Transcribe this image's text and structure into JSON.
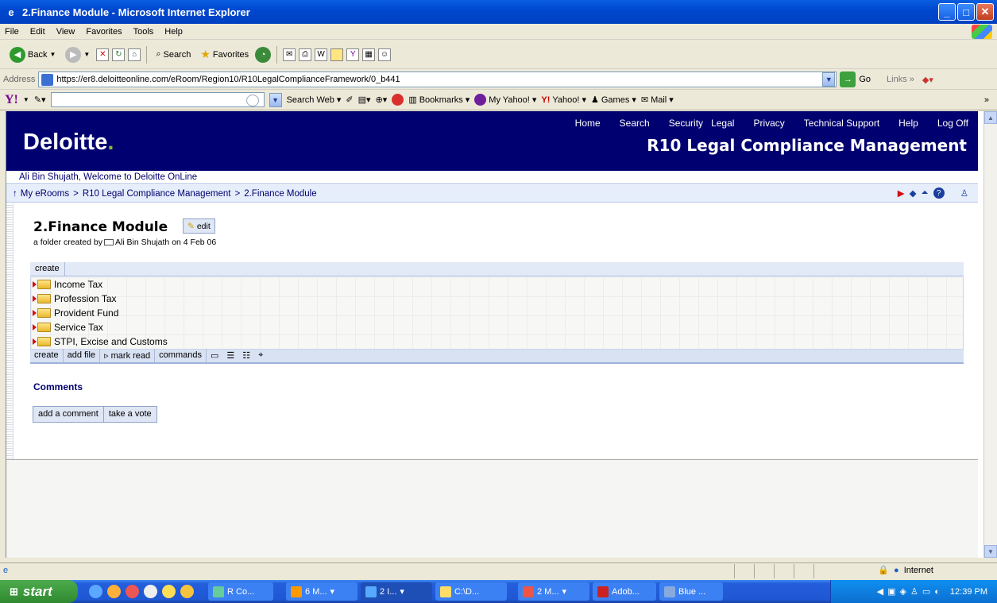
{
  "window": {
    "title": "2.Finance Module - Microsoft Internet Explorer",
    "min_icon": "minimize-icon",
    "max_icon": "maximize-icon",
    "close_icon": "close-icon"
  },
  "menu": [
    "File",
    "Edit",
    "View",
    "Favorites",
    "Tools",
    "Help"
  ],
  "toolbar": {
    "back": "Back",
    "search": "Search",
    "favorites": "Favorites"
  },
  "address": {
    "label": "Address",
    "url": "https://er8.deloitteonline.com/eRoom/Region10/R10LegalComplianceFramework/0_b441",
    "go": "Go",
    "links": "Links"
  },
  "yahoo": {
    "search_web": "Search Web",
    "bookmarks": "Bookmarks",
    "my_yahoo": "My Yahoo!",
    "yahoo": "Yahoo!",
    "games": "Games",
    "mail": "Mail"
  },
  "site": {
    "brand": "Deloitte",
    "brand_dot": ".",
    "nav": [
      "Home",
      "Search",
      "Security",
      "Legal",
      "Privacy",
      "Technical Support",
      "Help",
      "Log Off"
    ],
    "eroom_title": "R10 Legal Compliance Management",
    "welcome": "Ali Bin Shujath, Welcome to Deloitte OnLine",
    "breadcrumb": [
      "My eRooms",
      "R10 Legal Compliance Management",
      "2.Finance Module"
    ],
    "breadcrumb_sep": ">"
  },
  "folder": {
    "title": "2.Finance Module",
    "edit": "edit",
    "byline_prefix": "a folder created by",
    "author": "Ali Bin Shujath",
    "byline_suffix": "on 4 Feb 06",
    "create": "create",
    "items": [
      "Income Tax",
      "Profession Tax",
      "Provident Fund",
      "Service Tax",
      "STPI, Excise and Customs"
    ],
    "bottom_toolbar": [
      "create",
      "add file",
      "mark read",
      "commands"
    ]
  },
  "comments": {
    "heading": "Comments",
    "add": "add a comment",
    "vote": "take a vote"
  },
  "status": {
    "zone": "Internet"
  },
  "taskbar": {
    "start": "start",
    "buttons": [
      "R Co...",
      "6 M...",
      "2 I...",
      "C:\\D...",
      "2 M...",
      "Adob...",
      "Blue ..."
    ],
    "clock": "12:39 PM"
  },
  "colors": {
    "banner": "#000070",
    "brand_dot": "#86bc25",
    "breadcrumb_bg": "#e6eefb",
    "taskbar": "#245edb"
  }
}
